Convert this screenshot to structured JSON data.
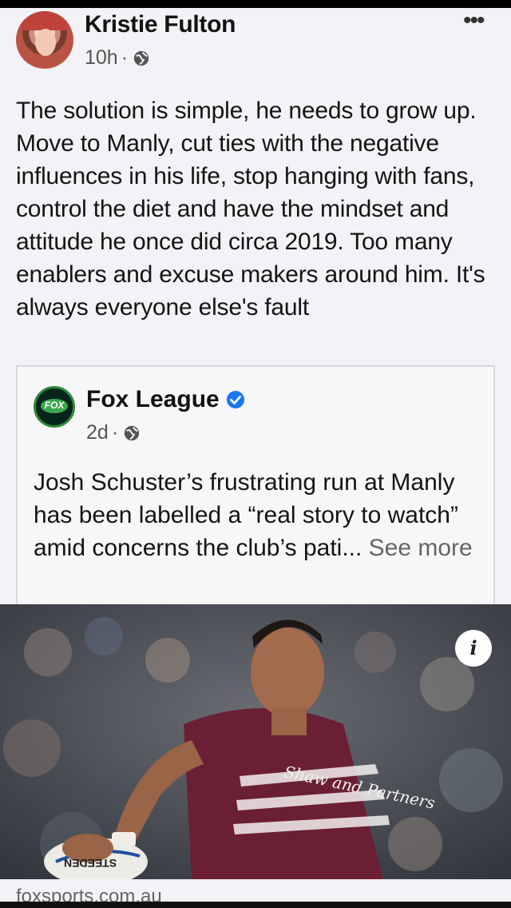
{
  "post": {
    "author": "Kristie Fulton",
    "time": "10h",
    "separator": "·",
    "privacy_icon": "globe-icon",
    "more_icon": "more-horizontal-icon",
    "more_glyph": "•••",
    "text": "The solution is simple, he needs to grow up. Move to Manly, cut ties with the negative influences in his life, stop hanging with fans, control the diet and have the mindset and attitude he once did circa 2019. Too many enablers and excuse makers around him. It's always everyone else's fault"
  },
  "shared_post": {
    "page_name": "Fox League",
    "verified_icon": "verified-badge-icon",
    "time": "2d",
    "separator": "·",
    "privacy_icon": "globe-icon",
    "logo_text": "FOX",
    "text": "Josh Schuster’s frustrating run at Manly has been labelled a “real story to watch” amid concerns the club’s pati...",
    "see_more": "See more"
  },
  "link_preview": {
    "image_description_icon": "info-icon",
    "info_glyph": "i",
    "jersey_sponsor": "Shaw and Partners",
    "ball_text": "STEEDEN",
    "domain": "foxsports.com.au"
  },
  "colors": {
    "card_background": "#f3f2f6",
    "verified_blue": "#1877f2",
    "manly_maroon": "#6b1f34",
    "fox_green": "#2c8a3a"
  }
}
